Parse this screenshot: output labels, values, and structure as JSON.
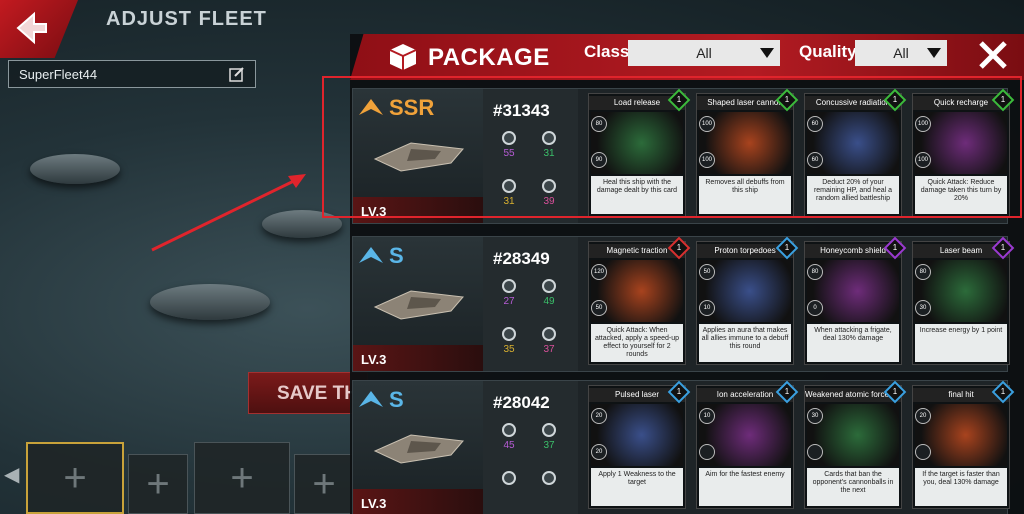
{
  "screen": {
    "title": "ADJUST FLEET"
  },
  "fleet": {
    "name": "SuperFleet44"
  },
  "save_button": {
    "label": "SAVE TH"
  },
  "panel": {
    "title": "PACKAGE",
    "class_label": "Class",
    "class_value": "All",
    "quality_label": "Quality",
    "quality_value": "All"
  },
  "ships": [
    {
      "rank": "SSR",
      "rank_color": "#f0a23a",
      "id": "#31343",
      "level": "LV.3",
      "stats": {
        "a": "55",
        "b": "31",
        "c": "31",
        "d": "39"
      },
      "cards": [
        {
          "title": "Load release",
          "cost_color": "#3cba3c",
          "desc": "Heal this ship with the damage dealt by this card",
          "badge1": "80",
          "badge2": "90"
        },
        {
          "title": "Shaped laser cannon",
          "cost_color": "#3cba3c",
          "desc": "Removes all debuffs from this ship",
          "badge1": "100",
          "badge2": "100"
        },
        {
          "title": "Concussive radiation",
          "cost_color": "#3cba3c",
          "desc": "Deduct 20% of your remaining HP, and heal a random allied battleship",
          "badge1": "60",
          "badge2": "60"
        },
        {
          "title": "Quick recharge",
          "cost_color": "#3cba3c",
          "desc": "Quick Attack: Reduce damage taken this turn by 20%",
          "badge1": "100",
          "badge2": "100"
        }
      ]
    },
    {
      "rank": "S",
      "rank_color": "#5ab6e8",
      "id": "#28349",
      "level": "LV.3",
      "stats": {
        "a": "27",
        "b": "49",
        "c": "35",
        "d": "37"
      },
      "cards": [
        {
          "title": "Magnetic traction",
          "cost_color": "#d83030",
          "desc": "Quick Attack: When attacked, apply a speed-up effect to yourself for 2 rounds",
          "badge1": "120",
          "badge2": "50"
        },
        {
          "title": "Proton torpedoes",
          "cost_color": "#3aa0e0",
          "desc": "Applies an aura that makes all allies immune to a debuff this round",
          "badge1": "50",
          "badge2": "10"
        },
        {
          "title": "Honeycomb shield",
          "cost_color": "#9a3ad0",
          "desc": "When attacking a frigate, deal 130% damage",
          "badge1": "80",
          "badge2": "0"
        },
        {
          "title": "Laser beam",
          "cost_color": "#9a3ad0",
          "desc": "Increase energy by 1 point",
          "badge1": "80",
          "badge2": "30"
        }
      ]
    },
    {
      "rank": "S",
      "rank_color": "#5ab6e8",
      "id": "#28042",
      "level": "LV.3",
      "stats": {
        "a": "45",
        "b": "37",
        "c": "",
        "d": ""
      },
      "cards": [
        {
          "title": "Pulsed laser",
          "cost_color": "#3aa0e0",
          "desc": "Apply 1 Weakness to the target",
          "badge1": "20",
          "badge2": "20"
        },
        {
          "title": "Ion acceleration",
          "cost_color": "#3aa0e0",
          "desc": "Aim for the fastest enemy",
          "badge1": "10",
          "badge2": ""
        },
        {
          "title": "Weakened atomic force field",
          "cost_color": "#3aa0e0",
          "desc": "Cards that ban the opponent's cannonballs in the next",
          "badge1": "30",
          "badge2": ""
        },
        {
          "title": "final hit",
          "cost_color": "#3aa0e0",
          "desc": "If the target is faster than you, deal 130% damage",
          "badge1": "20",
          "badge2": ""
        }
      ]
    }
  ]
}
